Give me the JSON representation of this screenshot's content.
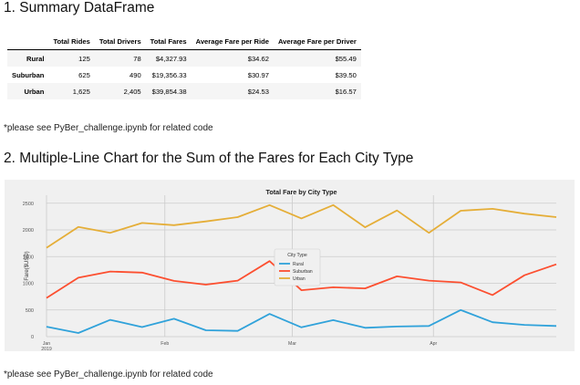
{
  "section1": {
    "heading": "1. Summary DataFrame"
  },
  "table": {
    "columns": [
      "",
      "Total Rides",
      "Total Drivers",
      "Total Fares",
      "Average Fare per Ride",
      "Average Fare per Driver"
    ],
    "rows": [
      [
        "Rural",
        "125",
        "78",
        "$4,327.93",
        "$34.62",
        "$55.49"
      ],
      [
        "Suburban",
        "625",
        "490",
        "$19,356.33",
        "$30.97",
        "$39.50"
      ],
      [
        "Urban",
        "1,625",
        "2,405",
        "$39,854.38",
        "$24.53",
        "$16.57"
      ]
    ]
  },
  "note1": "*please see PyBer_challenge.ipynb for related code",
  "section2": {
    "heading": "2. Multiple-Line Chart for the Sum of the Fares for Each City Type"
  },
  "note2": "*please see PyBer_challenge.ipynb for related code",
  "chart_data": {
    "type": "line",
    "title": "Total Fare by City Type",
    "xlabel": "",
    "ylabel": "Fare($USD)",
    "x": [
      "2019-01-06",
      "2019-01-13",
      "2019-01-20",
      "2019-01-27",
      "2019-02-03",
      "2019-02-10",
      "2019-02-17",
      "2019-02-24",
      "2019-03-03",
      "2019-03-10",
      "2019-03-17",
      "2019-03-24",
      "2019-03-31",
      "2019-04-07",
      "2019-04-14",
      "2019-04-21",
      "2019-04-28"
    ],
    "xlim": [
      "2019-01-06",
      "2019-04-28"
    ],
    "x_ticks": [
      "Jan\n2019",
      "Feb",
      "Mar",
      "Apr"
    ],
    "ylim": [
      0,
      2650
    ],
    "y_ticks": [
      "0",
      "500",
      "1000",
      "1500",
      "2000",
      "2500"
    ],
    "grid": true,
    "legend_title": "City Type",
    "legend_position": "center",
    "series": [
      {
        "name": "Rural",
        "color": "#30a2da",
        "values": [
          187,
          68,
          315,
          180,
          335,
          120,
          108,
          425,
          175,
          310,
          165,
          190,
          200,
          500,
          270,
          220,
          200
        ]
      },
      {
        "name": "Suburban",
        "color": "#fc4f30",
        "values": [
          725,
          1105,
          1220,
          1200,
          1045,
          975,
          1050,
          1415,
          870,
          925,
          905,
          1130,
          1050,
          1015,
          780,
          1150,
          1355
        ]
      },
      {
        "name": "Urban",
        "color": "#e5ae38",
        "values": [
          1665,
          2055,
          1945,
          2130,
          2090,
          2160,
          2240,
          2465,
          2215,
          2465,
          2050,
          2365,
          1945,
          2360,
          2395,
          2305,
          2240
        ]
      }
    ]
  }
}
